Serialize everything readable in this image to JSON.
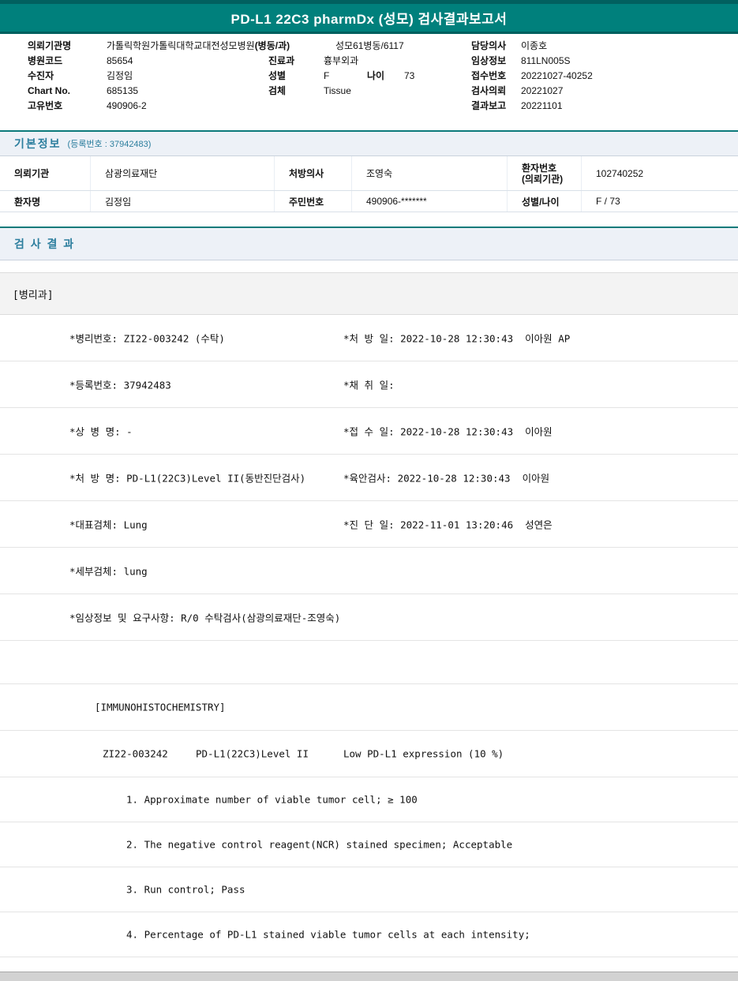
{
  "title_bar": {
    "title": "PD-L1 22C3 pharmDx (성모) 검사결과보고서"
  },
  "header_info": {
    "rows": [
      {
        "l1": "의뢰기관명",
        "v1": "가톨릭학원가톨릭대학교대전성모병원",
        "l2": "(병동/과)",
        "v2": "성모61병동/6117",
        "l3": "담당의사",
        "v3": "이종호"
      },
      {
        "l1": "병원코드",
        "v1": "85654",
        "l2": "진료과",
        "v2": "흉부외과",
        "l3": "임상정보",
        "v3": "811LN005S"
      },
      {
        "l1": "수진자",
        "v1": "김정임",
        "l2": "성별",
        "v2": "F",
        "l2b": "나이",
        "v2b": "73",
        "l3": "접수번호",
        "v3": "20221027-40252"
      },
      {
        "l1": "Chart No.",
        "v1": "685135",
        "l2": "검체",
        "v2": "Tissue",
        "l3": "검사의뢰",
        "v3": "20221027"
      },
      {
        "l1": "고유번호",
        "v1": "490906-2",
        "l3": "결과보고",
        "v3": "20221101"
      }
    ]
  },
  "basic_info": {
    "section_title": "기본정보",
    "section_sub": "(등록번호 : 37942483)",
    "rows": [
      {
        "l1": "의뢰기관",
        "v1": "삼광의료재단",
        "l2": "처방의사",
        "v2": "조영숙",
        "l3": "환자번호",
        "l3b": "(의뢰기관)",
        "v3": "102740252"
      },
      {
        "l1": "환자명",
        "v1": "김정임",
        "l2": "주민번호",
        "v2": "490906-*******",
        "l3": "성별/나이",
        "v3": "F / 73"
      }
    ]
  },
  "results_section": {
    "title": "검 사 결 과",
    "dept": "[병리과]"
  },
  "report": {
    "rows": [
      {
        "left": "*병리번호: ZI22-003242 (수탁)",
        "right": "*처 방 일: 2022-10-28 12:30:43  이아원 AP"
      },
      {
        "left": "*등록번호: 37942483",
        "right": "*채 취 일:"
      },
      {
        "left": "*상 병 명: -",
        "right": "*접 수 일: 2022-10-28 12:30:43  이아원"
      },
      {
        "left": "*처 방 명: PD-L1(22C3)Level II(동반진단검사)",
        "right": "*육안검사: 2022-10-28 12:30:43  이아원"
      },
      {
        "left": "*대표검체: Lung",
        "right": "*진 단 일: 2022-11-01 13:20:46  성연은"
      },
      {
        "left": "*세부검체: lung",
        "right": ""
      },
      {
        "left": "*임상정보 및 요구사항: R/0 수탁검사(삼광의료재단-조영숙)",
        "right": ""
      }
    ],
    "ihc": {
      "header": "[IMMUNOHISTOCHEMISTRY]",
      "result": {
        "no": "ZI22-003242",
        "test": "PD-L1(22C3)Level II",
        "value": "Low PD-L1 expression (10 %)"
      },
      "items": [
        "1. Approximate number of viable tumor cell; ≥ 100",
        "2. The negative control reagent(NCR) stained specimen; Acceptable",
        "3. Run control; Pass",
        "4. Percentage of PD-L1 stained viable tumor cells at each intensity;"
      ]
    }
  }
}
